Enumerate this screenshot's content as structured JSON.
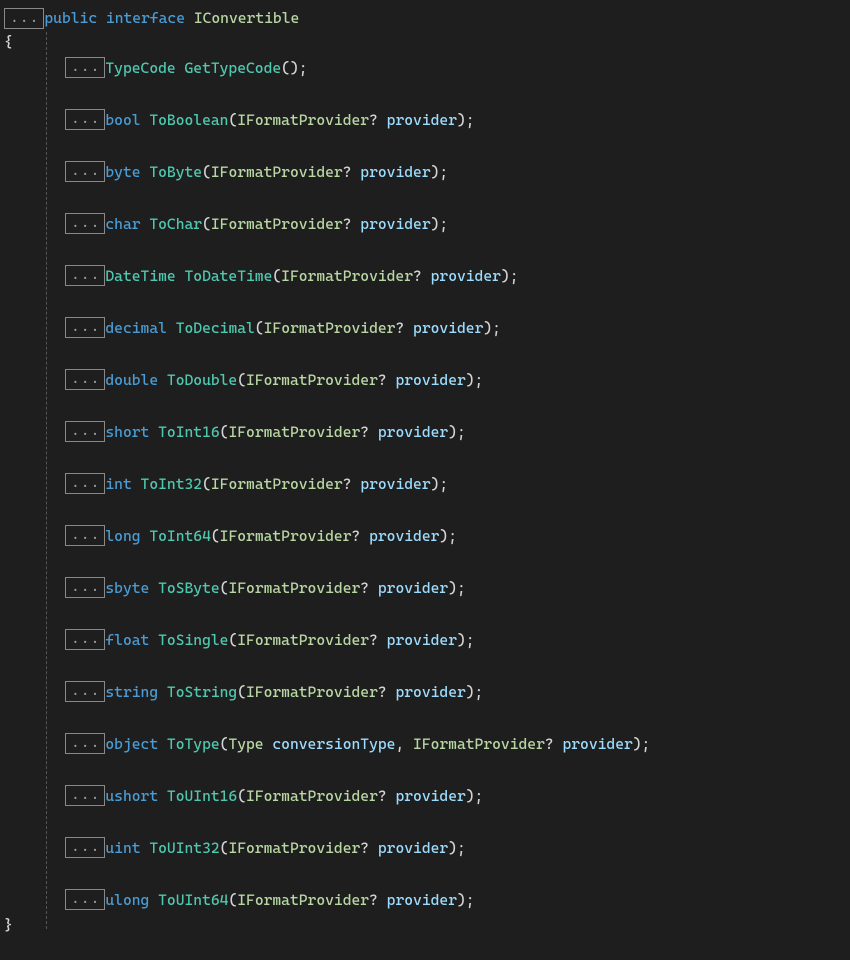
{
  "ellipsis": "...",
  "header": {
    "public": "public",
    "interface": "interface",
    "name": "IConvertible"
  },
  "open_brace": "{",
  "close_brace": "}",
  "members": [
    {
      "ret": "TypeCode",
      "retClass": "type",
      "name": "GetTypeCode",
      "params": []
    },
    {
      "ret": "bool",
      "retClass": "kw",
      "name": "ToBoolean",
      "params": [
        {
          "type": "IFormatProvider",
          "nullable": "?",
          "name": "provider"
        }
      ]
    },
    {
      "ret": "byte",
      "retClass": "kw",
      "name": "ToByte",
      "params": [
        {
          "type": "IFormatProvider",
          "nullable": "?",
          "name": "provider"
        }
      ]
    },
    {
      "ret": "char",
      "retClass": "kw",
      "name": "ToChar",
      "params": [
        {
          "type": "IFormatProvider",
          "nullable": "?",
          "name": "provider"
        }
      ]
    },
    {
      "ret": "DateTime",
      "retClass": "type",
      "name": "ToDateTime",
      "params": [
        {
          "type": "IFormatProvider",
          "nullable": "?",
          "name": "provider"
        }
      ]
    },
    {
      "ret": "decimal",
      "retClass": "kw",
      "name": "ToDecimal",
      "params": [
        {
          "type": "IFormatProvider",
          "nullable": "?",
          "name": "provider"
        }
      ]
    },
    {
      "ret": "double",
      "retClass": "kw",
      "name": "ToDouble",
      "params": [
        {
          "type": "IFormatProvider",
          "nullable": "?",
          "name": "provider"
        }
      ]
    },
    {
      "ret": "short",
      "retClass": "kw",
      "name": "ToInt16",
      "params": [
        {
          "type": "IFormatProvider",
          "nullable": "?",
          "name": "provider"
        }
      ]
    },
    {
      "ret": "int",
      "retClass": "kw",
      "name": "ToInt32",
      "params": [
        {
          "type": "IFormatProvider",
          "nullable": "?",
          "name": "provider"
        }
      ]
    },
    {
      "ret": "long",
      "retClass": "kw",
      "name": "ToInt64",
      "params": [
        {
          "type": "IFormatProvider",
          "nullable": "?",
          "name": "provider"
        }
      ]
    },
    {
      "ret": "sbyte",
      "retClass": "kw",
      "name": "ToSByte",
      "params": [
        {
          "type": "IFormatProvider",
          "nullable": "?",
          "name": "provider"
        }
      ]
    },
    {
      "ret": "float",
      "retClass": "kw",
      "name": "ToSingle",
      "params": [
        {
          "type": "IFormatProvider",
          "nullable": "?",
          "name": "provider"
        }
      ]
    },
    {
      "ret": "string",
      "retClass": "kw",
      "name": "ToString",
      "params": [
        {
          "type": "IFormatProvider",
          "nullable": "?",
          "name": "provider"
        }
      ]
    },
    {
      "ret": "object",
      "retClass": "kw",
      "name": "ToType",
      "params": [
        {
          "type": "Type",
          "nullable": "",
          "name": "conversionType"
        },
        {
          "type": "IFormatProvider",
          "nullable": "?",
          "name": "provider"
        }
      ]
    },
    {
      "ret": "ushort",
      "retClass": "kw",
      "name": "ToUInt16",
      "params": [
        {
          "type": "IFormatProvider",
          "nullable": "?",
          "name": "provider"
        }
      ]
    },
    {
      "ret": "uint",
      "retClass": "kw",
      "name": "ToUInt32",
      "params": [
        {
          "type": "IFormatProvider",
          "nullable": "?",
          "name": "provider"
        }
      ]
    },
    {
      "ret": "ulong",
      "retClass": "kw",
      "name": "ToUInt64",
      "params": [
        {
          "type": "IFormatProvider",
          "nullable": "?",
          "name": "provider"
        }
      ]
    }
  ]
}
